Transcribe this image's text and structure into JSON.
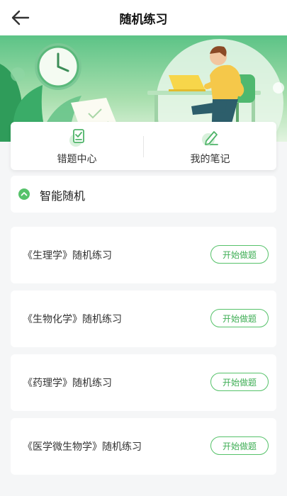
{
  "header": {
    "title": "随机练习"
  },
  "quick_actions": [
    {
      "label": "错题中心",
      "icon": "wrong-questions-icon"
    },
    {
      "label": "我的笔记",
      "icon": "notes-icon"
    }
  ],
  "section": {
    "title": "智能随机",
    "icon": "collapse-chevron-icon"
  },
  "practice_items": [
    {
      "title": "《生理学》随机练习",
      "button": "开始做题"
    },
    {
      "title": "《生物化学》随机练习",
      "button": "开始做题"
    },
    {
      "title": "《药理学》随机练习",
      "button": "开始做题"
    },
    {
      "title": "《医学微生物学》随机练习",
      "button": "开始做题"
    }
  ],
  "colors": {
    "accent": "#56c26a",
    "banner_top": "#63c98b",
    "banner_bottom": "#d9f0d8"
  }
}
